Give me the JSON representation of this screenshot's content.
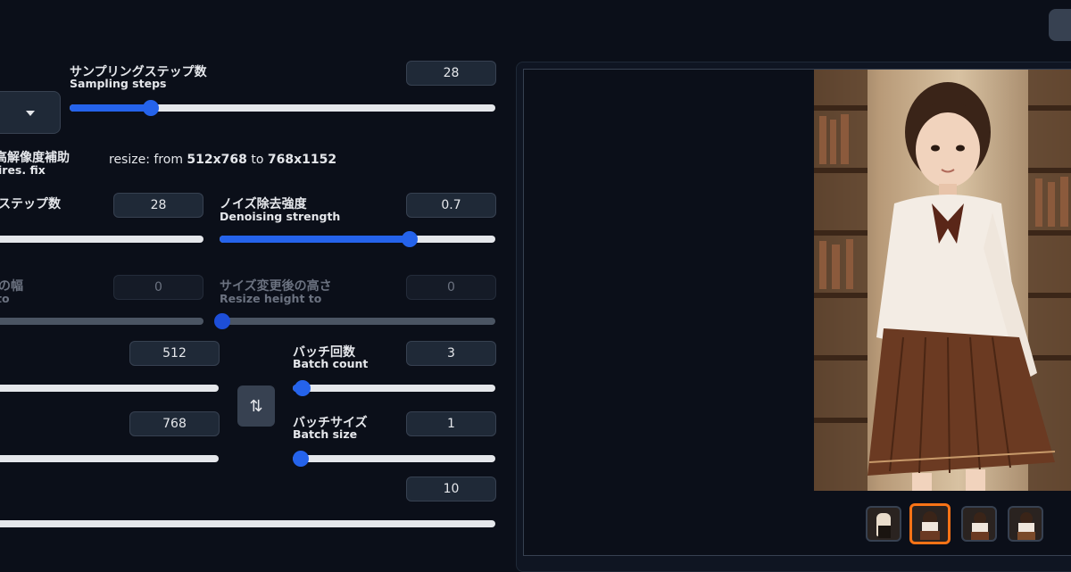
{
  "sampling_steps": {
    "label_jp": "サンプリングステップ数",
    "label_en": "Sampling steps",
    "value": "28",
    "fraction": 0.19
  },
  "dropdown": {
    "icon": "caret-down-icon"
  },
  "hires": {
    "label_jp": "高解像度補助",
    "label_en": "ires. fix",
    "resize_prefix": "resize: from ",
    "resize_from": "512x768",
    "resize_mid": " to ",
    "resize_to": "768x1152"
  },
  "hires_steps": {
    "label_jp": "ステップ数",
    "value": "28"
  },
  "denoising": {
    "label_jp": "ノイズ除去強度",
    "label_en": "Denoising strength",
    "value": "0.7",
    "fraction": 0.7
  },
  "resize_width": {
    "label_jp": "の幅",
    "label_en": "to",
    "value": "0"
  },
  "resize_height": {
    "label_jp": "サイズ変更後の高さ",
    "label_en": "Resize height to",
    "value": "0"
  },
  "width": {
    "value": "512"
  },
  "height": {
    "value": "768"
  },
  "swap_button": {
    "icon": "swap-vertical-icon",
    "glyph": "⇅"
  },
  "batch_count": {
    "label_jp": "バッチ回数",
    "label_en": "Batch count",
    "value": "3",
    "fraction": 0.05
  },
  "batch_size": {
    "label_jp": "バッチサイズ",
    "label_en": "Batch size",
    "value": "1",
    "fraction": 0.0
  },
  "cfg": {
    "value": "10"
  },
  "colors": {
    "accent": "#2563eb",
    "selected_thumb": "#f97316",
    "background": "#0b0f19"
  }
}
